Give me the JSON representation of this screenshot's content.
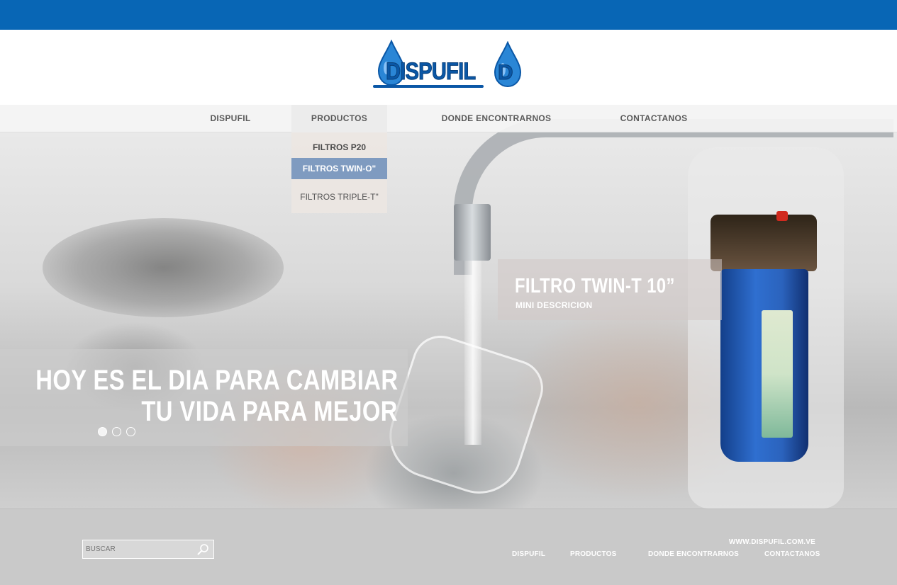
{
  "colors": {
    "topbar": "#0866b5",
    "brand_blue": "#0a57a6",
    "dropdown_selected": "#7f9bc0",
    "footer_bg": "#c9c9c9"
  },
  "logo": {
    "text": "DISPUFIL",
    "d_text": "D",
    "icon": "water-drop-icon"
  },
  "nav": {
    "items": [
      "DISPUFIL",
      "PRODUCTOS",
      "DONDE ENCONTRARNOS",
      "CONTACTANOS"
    ],
    "active": "PRODUCTOS",
    "dropdown": [
      "FILTROS P20",
      "FILTROS TWIN-O\"",
      "FILTROS TRIPLE-T\""
    ],
    "dropdown_selected": "FILTROS TWIN-O\""
  },
  "hero": {
    "product_title": "FILTRO TWIN-T 10”",
    "product_subtitle": "MINI DESCRICION",
    "slogan_line1": "HOY ES EL DIA PARA CAMBIAR",
    "slogan_line2": "TU VIDA PARA MEJOR",
    "slides": 3,
    "active_slide": 1
  },
  "footer": {
    "search_placeholder": "BUSCAR",
    "search_icon": "search-icon",
    "url": "WWW.DISPUFIL.COM.VE",
    "links": [
      "DISPUFIL",
      "PRODUCTOS",
      "DONDE ENCONTRARNOS",
      "CONTACTANOS"
    ]
  }
}
